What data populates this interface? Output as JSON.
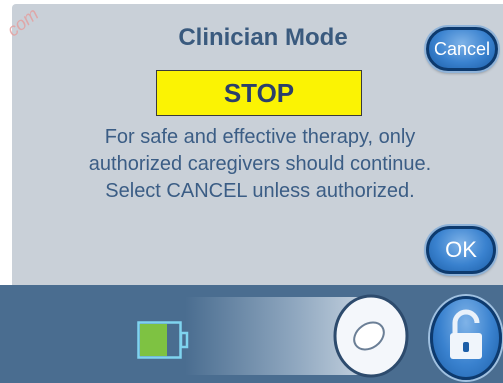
{
  "header": {
    "title": "Clinician Mode"
  },
  "alert": {
    "label": "STOP"
  },
  "message": {
    "line1": "For safe and effective therapy, only",
    "line2": "authorized caregivers should continue.",
    "line3": "Select CANCEL unless authorized."
  },
  "buttons": {
    "cancel_label": "Cancel",
    "ok_label": "OK"
  },
  "watermark": "com",
  "colors": {
    "panel_bg": "#c9d0d8",
    "title": "#3a5a7e",
    "stop_bg": "#fbf303",
    "button_blue": "#3a82cf",
    "bottom_bar": "#4a6d90",
    "battery_fill": "#7ec242"
  },
  "status": {
    "battery_level_fraction": 0.7
  },
  "icons": {
    "battery": "battery-icon",
    "slider": "slider-knob-icon",
    "lock": "unlocked-padlock-icon"
  }
}
